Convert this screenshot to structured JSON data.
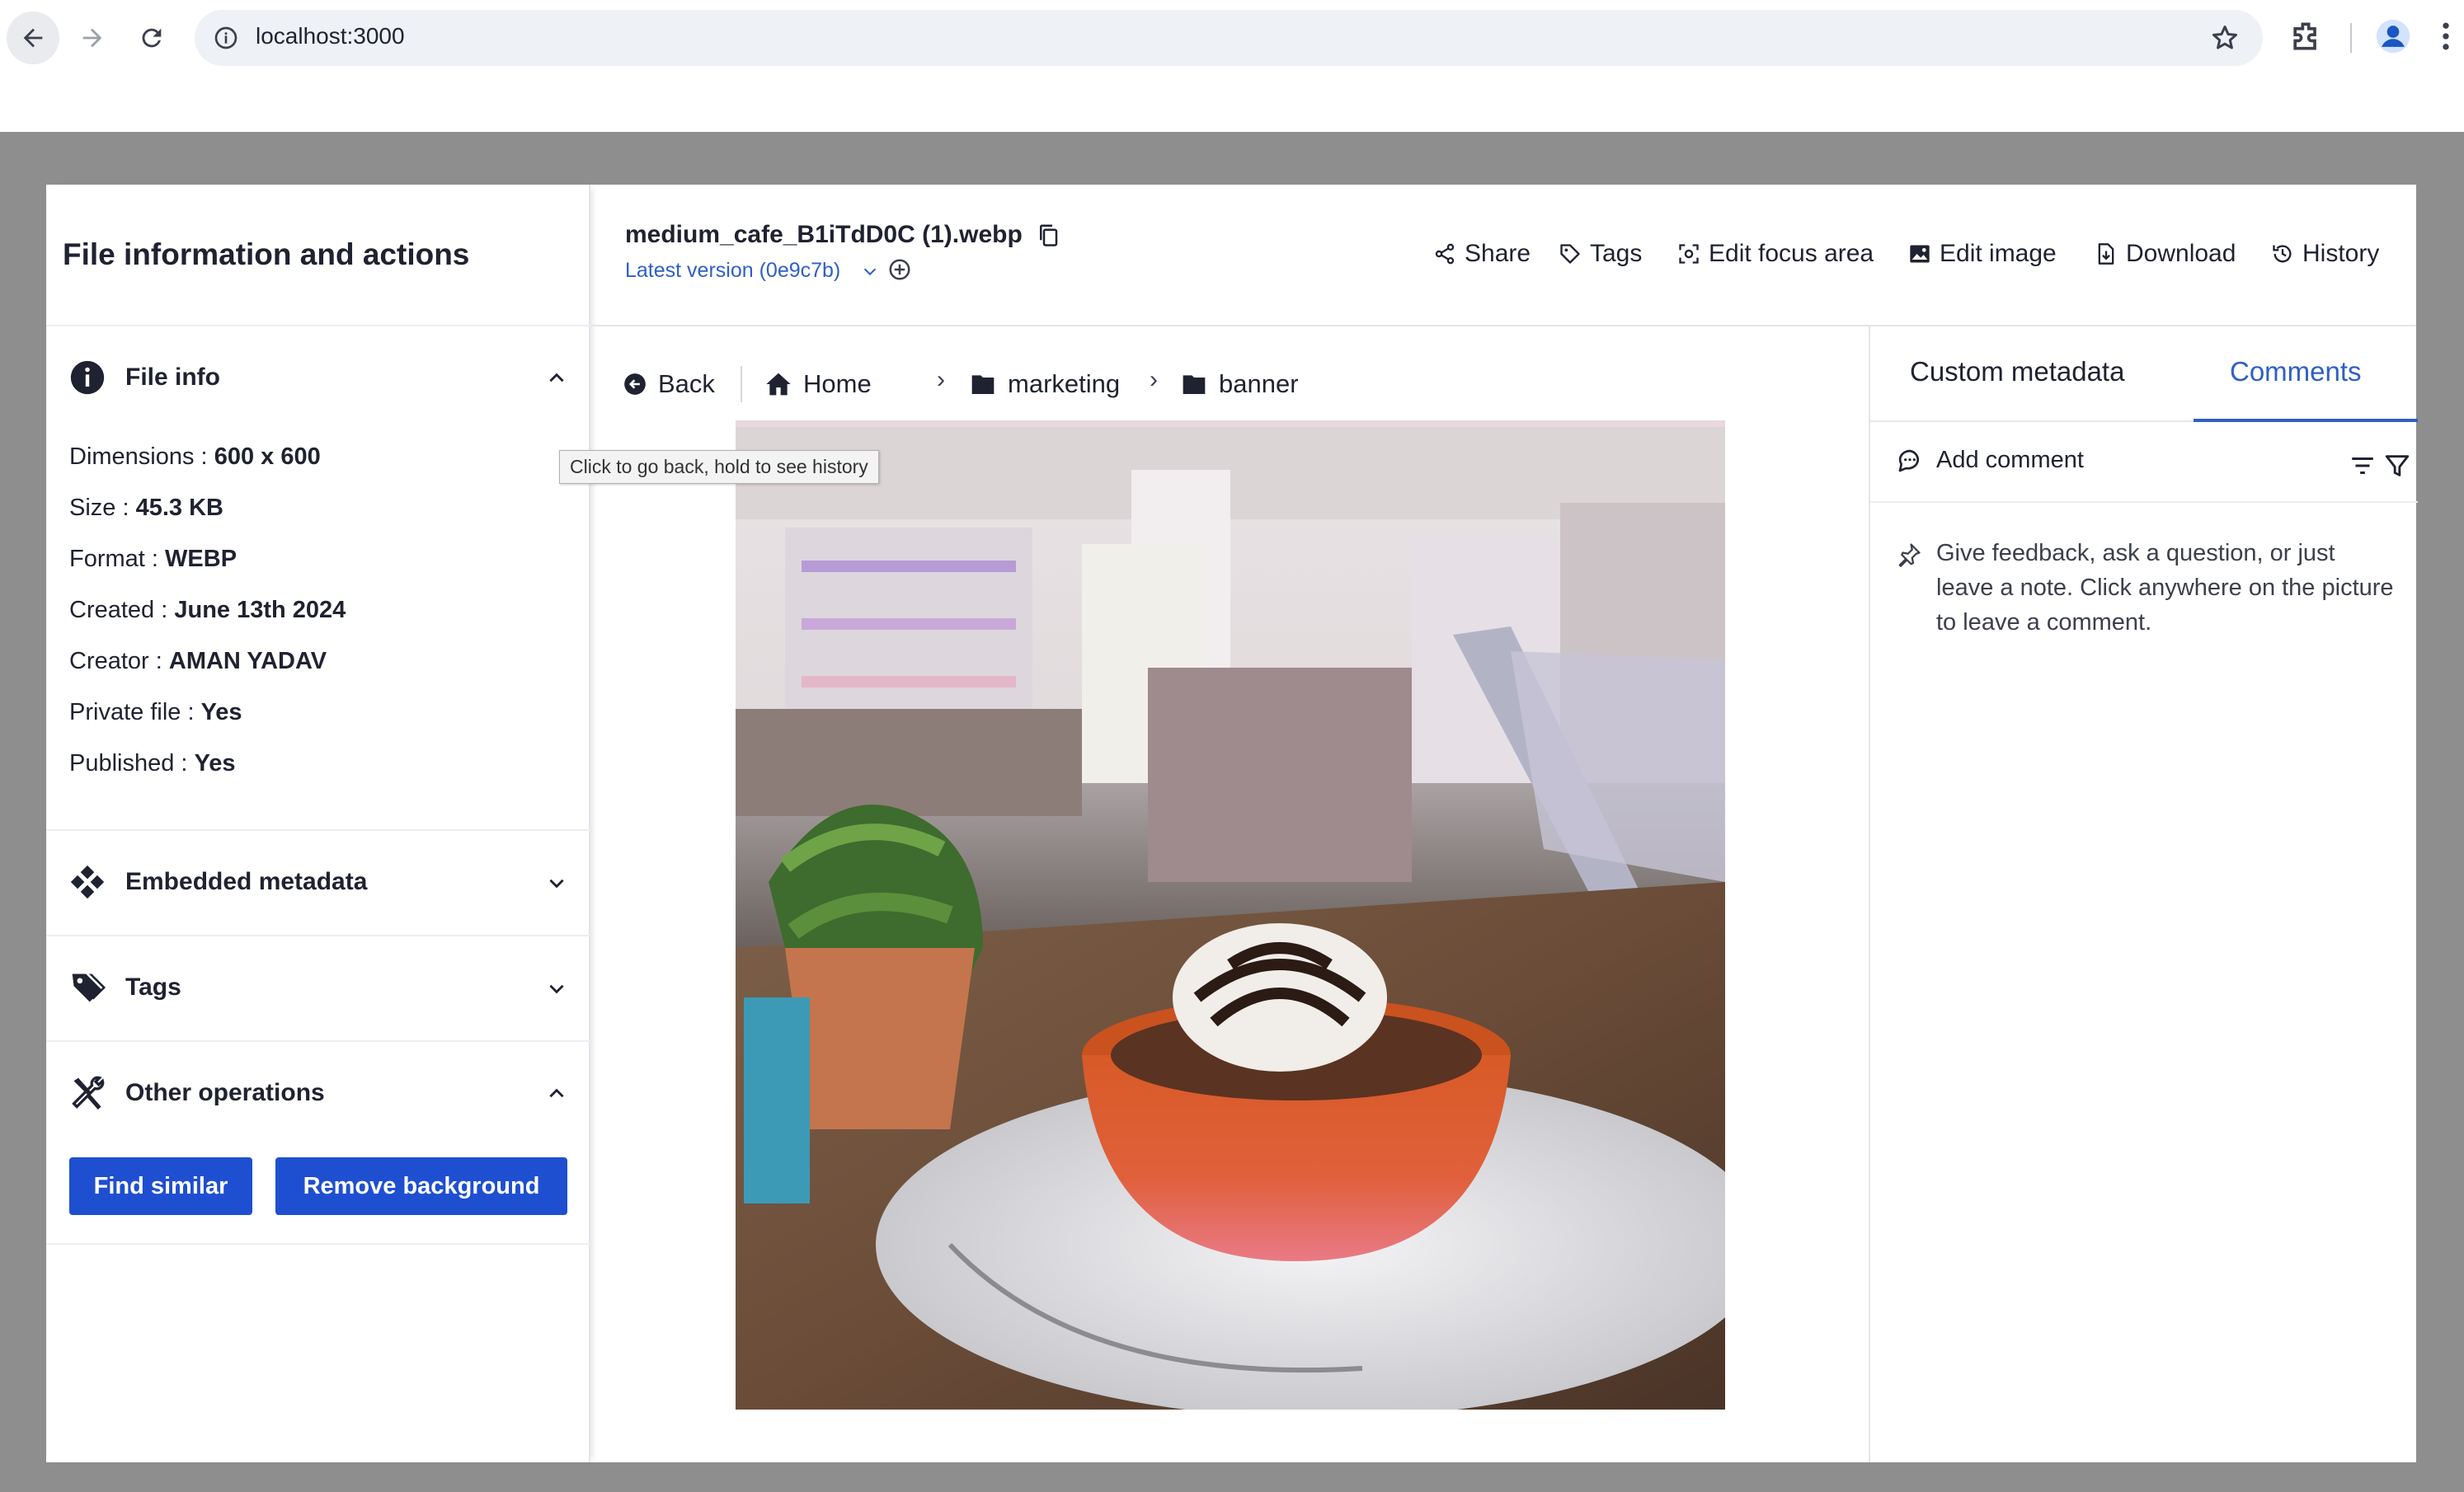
{
  "browser": {
    "url": "localhost:3000"
  },
  "left_panel": {
    "title": "File information and actions",
    "file_info": {
      "label": "File info",
      "rows": [
        {
          "key": "Dimensions :",
          "value": "600 x 600"
        },
        {
          "key": "Size :",
          "value": "45.3 KB"
        },
        {
          "key": "Format :",
          "value": "WEBP"
        },
        {
          "key": "Created :",
          "value": "June 13th 2024"
        },
        {
          "key": "Creator :",
          "value": "AMAN YADAV"
        },
        {
          "key": "Private file :",
          "value": "Yes"
        },
        {
          "key": "Published :",
          "value": "Yes"
        }
      ]
    },
    "embedded_metadata_label": "Embedded metadata",
    "tags_label": "Tags",
    "other_operations_label": "Other operations",
    "find_similar_label": "Find similar",
    "remove_background_label": "Remove background"
  },
  "header": {
    "file_name": "medium_cafe_B1iTdD0C (1).webp",
    "version": "Latest version (0e9c7b)",
    "actions": {
      "share": "Share",
      "tags": "Tags",
      "edit_focus_area": "Edit focus area",
      "edit_image": "Edit image",
      "download": "Download",
      "history": "History"
    }
  },
  "breadcrumb": {
    "back": "Back",
    "home": "Home",
    "folder1": "marketing",
    "folder2": "banner",
    "separator": "›",
    "tooltip": "Click to go back, hold to see history"
  },
  "right_panel": {
    "tabs": {
      "custom_metadata": "Custom metadata",
      "comments": "Comments"
    },
    "add_comment": "Add comment",
    "hint": "Give feedback, ask a question, or just leave a note. Click anywhere on the picture to leave a comment."
  },
  "colors": {
    "primary": "#1e4fd0",
    "link": "#2f5fc4",
    "backdrop": "#8e8e8e"
  }
}
